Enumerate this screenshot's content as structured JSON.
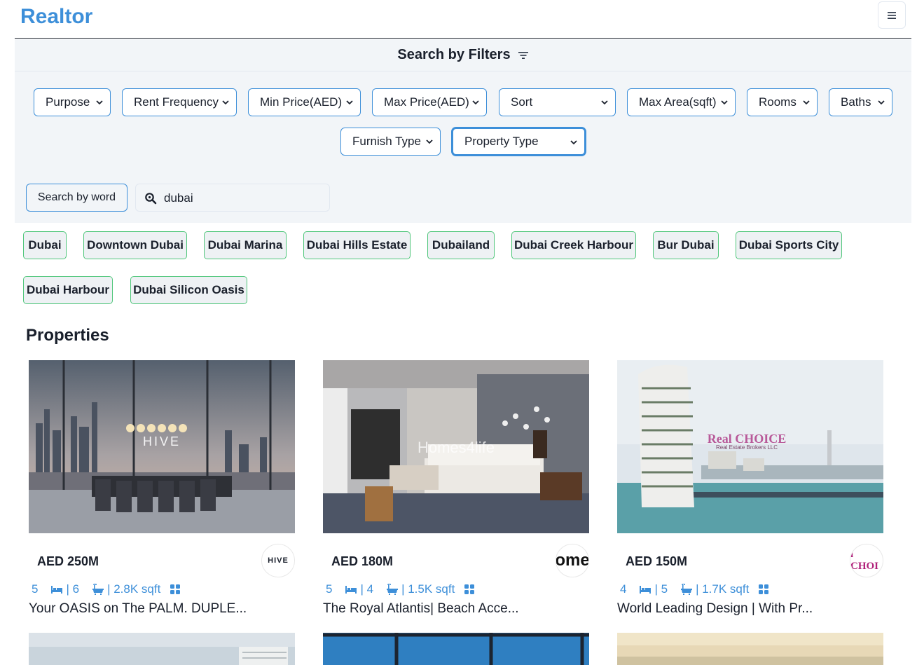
{
  "app": {
    "brand": "Realtor"
  },
  "filters": {
    "title": "Search by Filters",
    "selects": [
      "Purpose",
      "Rent Frequency",
      "Min Price(AED)",
      "Max Price(AED)",
      "Sort",
      "Max Area(sqft)",
      "Rooms",
      "Baths",
      "Furnish Type",
      "Property Type"
    ],
    "search_by_word_label": "Search by word",
    "search_value": "dubai"
  },
  "location_tags": [
    "Dubai",
    "Downtown Dubai",
    "Dubai Marina",
    "Dubai Hills Estate",
    "Dubailand",
    "Dubai Creek Harbour",
    "Bur Dubai",
    "Dubai Sports City",
    "Dubai Harbour",
    "Dubai Silicon Oasis"
  ],
  "properties": {
    "heading": "Properties",
    "cards": [
      {
        "price": "AED 250M",
        "rooms": "5",
        "baths": "| 6",
        "area": "| 2.8K sqft",
        "title": "Your OASIS on The PALM. DUPLE...",
        "photo_text": "HIVE",
        "agency_text": "HIVE"
      },
      {
        "price": "AED 180M",
        "rooms": "5",
        "baths": "| 4",
        "area": "| 1.5K sqft",
        "title": "The Royal Atlantis| Beach Acce...",
        "photo_text": "Homes4life",
        "agency_text": "ome"
      },
      {
        "price": "AED 150M",
        "rooms": "4",
        "baths": "| 5",
        "area": "| 1.7K sqft",
        "title": "World Leading Design | With Pr...",
        "photo_text": "Real CHOICE",
        "photo_subtext": "Real Estate Brokers LLC",
        "agency_text": "l CHOI"
      }
    ]
  },
  "colors": {
    "accent": "#3d8fd9",
    "tag_border": "#4fc67a",
    "panel_bg": "#f2f5f8"
  }
}
